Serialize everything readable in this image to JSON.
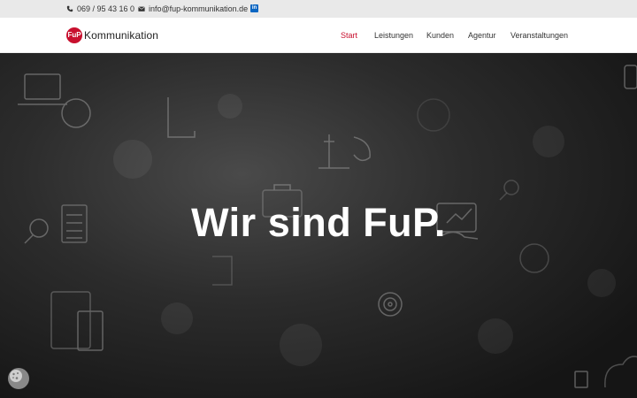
{
  "topbar": {
    "phone": "069 / 95 43 16 0",
    "email": "info@fup-kommunikation.de",
    "linkedin": "in"
  },
  "header": {
    "logo_mark": "FuP",
    "logo_text": "Kommunikation",
    "nav": [
      {
        "label": "Start",
        "active": true
      },
      {
        "label": "Leistungen",
        "active": false
      },
      {
        "label": "Kunden",
        "active": false
      },
      {
        "label": "Agentur",
        "active": false
      },
      {
        "label": "Veranstaltungen",
        "active": false
      }
    ]
  },
  "hero": {
    "title": "Wir sind FuP."
  },
  "colors": {
    "brand_red": "#c8102e",
    "topbar_bg": "#e9e9e9",
    "hero_dark": "#1c1c1c"
  }
}
